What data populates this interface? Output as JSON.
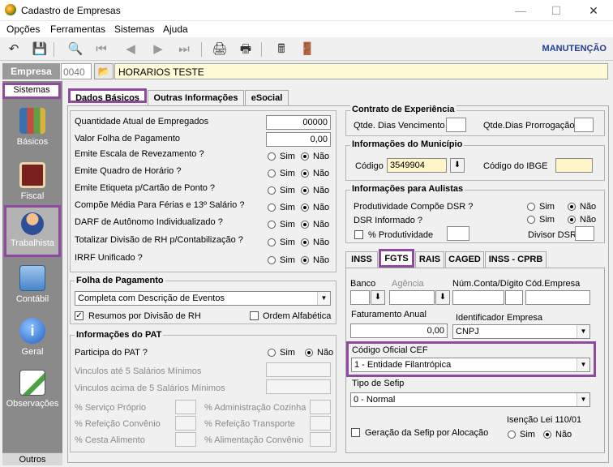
{
  "window": {
    "title": "Cadastro de Empresas"
  },
  "menu": [
    "Opções",
    "Ferramentas",
    "Sistemas",
    "Ajuda"
  ],
  "toolbar": {
    "mode": "MANUTENÇÃO",
    "icons": [
      "undo-icon",
      "save-icon",
      "preview-icon",
      "first-icon",
      "prev-icon",
      "next-icon",
      "last-icon",
      "print-icon",
      "print-setup-icon",
      "calculator-icon",
      "exit-icon"
    ]
  },
  "empresa": {
    "label": "Empresa",
    "code": "0040",
    "name": "HORARIOS TESTE"
  },
  "sidebar": {
    "header": "Sistemas",
    "items": [
      {
        "label": "Básicos",
        "icon": "books-icon"
      },
      {
        "label": "Fiscal",
        "icon": "ledger-icon"
      },
      {
        "label": "Trabalhista",
        "icon": "worker-icon"
      },
      {
        "label": "Contábil",
        "icon": "calculator-icon"
      },
      {
        "label": "Geral",
        "icon": "info-icon"
      },
      {
        "label": "Observações",
        "icon": "notepad-icon"
      }
    ],
    "footer": "Outros"
  },
  "tabs": [
    "Dados Básicos",
    "Outras Informações",
    "eSocial"
  ],
  "dados": {
    "qtd_empregados_label": "Quantidade Atual de Empregados",
    "qtd_empregados": "00000",
    "valor_folha_label": "Valor Folha de Pagamento",
    "valor_folha": "0,00",
    "radio_rows": [
      {
        "label": "Emite Escala de Revezamento ?",
        "value": "Não"
      },
      {
        "label": "Emite Quadro de Horário ?",
        "value": "Não"
      },
      {
        "label": "Emite Etiqueta p/Cartão de Ponto ?",
        "value": "Não"
      },
      {
        "label": "Compõe Média Para Férias e 13º Salário ?",
        "value": "Não"
      },
      {
        "label": "DARF de Autônomo Individualizado ?",
        "value": "Não"
      },
      {
        "label": "Totalizar Divisão de RH p/Contabilização ?",
        "value": "Não"
      },
      {
        "label": "IRRF Unificado ?",
        "value": "Não"
      }
    ],
    "sim": "Sim",
    "nao": "Não"
  },
  "folha": {
    "title": "Folha de Pagamento",
    "select": "Completa com Descrição de Eventos",
    "resumos_label": "Resumos por Divisão de RH",
    "resumos_checked": true,
    "ordem_label": "Ordem Alfabética",
    "ordem_checked": false
  },
  "pat": {
    "title": "Informações do PAT",
    "participa_label": "Participa do PAT ?",
    "participa": "Não",
    "vinc_ate": "Vinculos até 5 Salários Mínimos",
    "vinc_acima": "Vinculos acima de 5 Salários Mínimos",
    "servico": "% Serviço Próprio",
    "refeicao": "% Refeição Convênio",
    "cesta": "% Cesta Alimento",
    "adm": "% Administração Cozinha",
    "transp": "% Refeição Transporte",
    "alim": "% Alimentação Convênio"
  },
  "contrato": {
    "title": "Contrato de Experiência",
    "dias_venc": "Qtde. Dias Vencimento",
    "dias_prorrog": "Qtde.Dias Prorrogação"
  },
  "municipio": {
    "title": "Informações do Município",
    "codigo_label": "Código",
    "codigo": "3549904",
    "ibge_label": "Código do IBGE"
  },
  "aulistas": {
    "title": "Informações para Aulistas",
    "prod_label": "Produtividade Compõe DSR ?",
    "prod": "Não",
    "dsr_label": "DSR Informado ?",
    "dsr": "Não",
    "pct_label": "% Produtividade",
    "divisor_label": "Divisor DSR"
  },
  "subtabs": [
    "INSS",
    "FGTS",
    "RAIS",
    "CAGED",
    "INSS - CPRB"
  ],
  "fgts": {
    "banco": "Banco",
    "agencia": "Agência",
    "conta": "Núm.Conta/Dígito",
    "cod_empresa": "Cód.Empresa",
    "fat_label": "Faturamento Anual",
    "fat_value": "0,00",
    "ident_label": "Identificador Empresa",
    "ident_value": "CNPJ",
    "cef_label": "Código Oficial CEF",
    "cef_value": "1 - Entidade Filantrópica",
    "sefip_label": "Tipo de Sefip",
    "sefip_value": "0 - Normal",
    "geracao_label": "Geração da Sefip por Alocação",
    "isencao_label": "Isenção Lei 110/01",
    "isencao": "Não"
  }
}
